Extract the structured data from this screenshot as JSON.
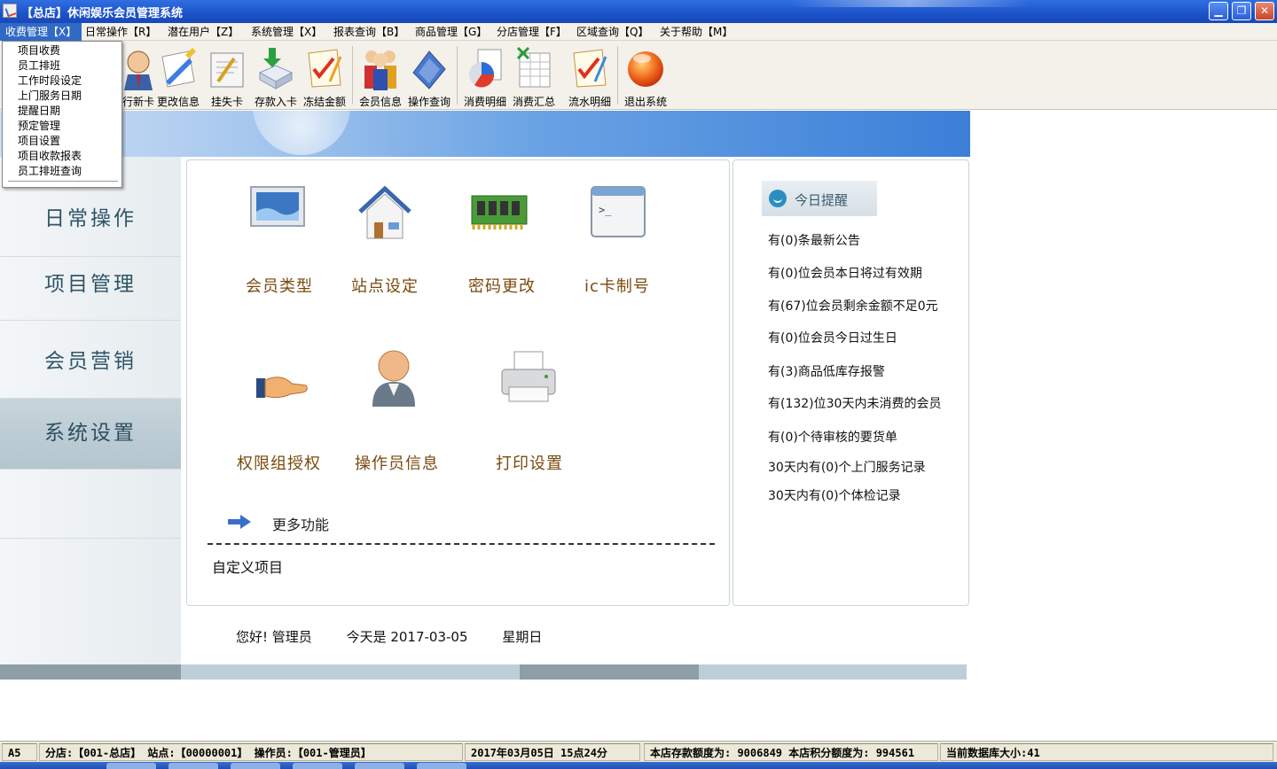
{
  "window": {
    "title": "【总店】休闲娱乐会员管理系统",
    "min_glyph": "▁",
    "max_glyph": "❐",
    "close_glyph": "✕"
  },
  "menubar": {
    "items": [
      {
        "label": "收费管理【X】"
      },
      {
        "label": "日常操作【R】"
      },
      {
        "label": "潜在用户【Z】"
      },
      {
        "label": "系统管理【X】"
      },
      {
        "label": "报表查询【B】"
      },
      {
        "label": "商品管理【G】"
      },
      {
        "label": "分店管理【F】"
      },
      {
        "label": "区域查询【Q】"
      },
      {
        "label": "关于帮助【M】"
      }
    ]
  },
  "dropdown": {
    "items": [
      "项目收费",
      "员工排班",
      "工作时段设定",
      "上门服务日期",
      "提醒日期",
      "预定管理",
      "项目设置",
      "项目收款报表",
      "员工排班查询"
    ]
  },
  "toolbar": {
    "items": [
      {
        "label": "行新卡",
        "icon": "new-card-icon"
      },
      {
        "label": "更改信息",
        "icon": "edit-info-icon"
      },
      {
        "label": "挂失卡",
        "icon": "lost-card-icon"
      },
      {
        "label": "存款入卡",
        "icon": "deposit-icon"
      },
      {
        "label": "冻结金额",
        "icon": "freeze-icon"
      },
      {
        "label": "会员信息",
        "icon": "member-info-icon"
      },
      {
        "label": "操作查询",
        "icon": "operation-query-icon"
      },
      {
        "label": "消费明细",
        "icon": "consumption-detail-icon"
      },
      {
        "label": "消费汇总",
        "icon": "consumption-summary-icon"
      },
      {
        "label": "流水明细",
        "icon": "transaction-detail-icon"
      },
      {
        "label": "退出系统",
        "icon": "exit-icon"
      }
    ]
  },
  "leftnav": {
    "items": [
      {
        "label": "日常操作"
      },
      {
        "label": "项目管理"
      },
      {
        "label": "会员营销"
      },
      {
        "label": "系统设置",
        "active": true
      }
    ]
  },
  "main": {
    "tiles": [
      {
        "label": "会员类型",
        "icon": "monitor-icon"
      },
      {
        "label": "站点设定",
        "icon": "house-icon"
      },
      {
        "label": "密码更改",
        "icon": "memory-chip-icon"
      },
      {
        "label": "ic卡制号",
        "icon": "terminal-window-icon"
      },
      {
        "label": "权限组授权",
        "icon": "hand-icon"
      },
      {
        "label": "操作员信息",
        "icon": "user-icon"
      },
      {
        "label": "打印设置",
        "icon": "printer-icon"
      }
    ],
    "more_label": "更多功能",
    "custom_label": "自定义项目"
  },
  "reminder": {
    "title": "今日提醒",
    "lines": [
      "有(0)条最新公告",
      "有(0)位会员本日将过有效期",
      "有(67)位会员剩余金额不足0元",
      "有(0)位会员今日过生日",
      "有(3)商品低库存报警",
      "有(132)位30天内未消费的会员",
      "有(0)个待审核的要货单",
      "30天内有(0)个上门服务记录",
      "30天内有(0)个体检记录"
    ]
  },
  "greeting": {
    "hello": "您好! 管理员",
    "today": "今天是 2017-03-05",
    "weekday": "星期日"
  },
  "statusbar": {
    "cells": [
      "A5",
      "分店:【001-总店】 站点:【00000001】  操作员:【001-管理员】",
      "2017年03月05日 15点24分",
      "本店存款额度为: 9006849 本店积分额度为: 994561",
      "当前数据库大小:41"
    ]
  },
  "colors": {
    "title_blue": "#1c52c9",
    "menu_highlight": "#316ac5",
    "tile_text": "#7a4a0e",
    "nav_text": "#2f5567"
  }
}
